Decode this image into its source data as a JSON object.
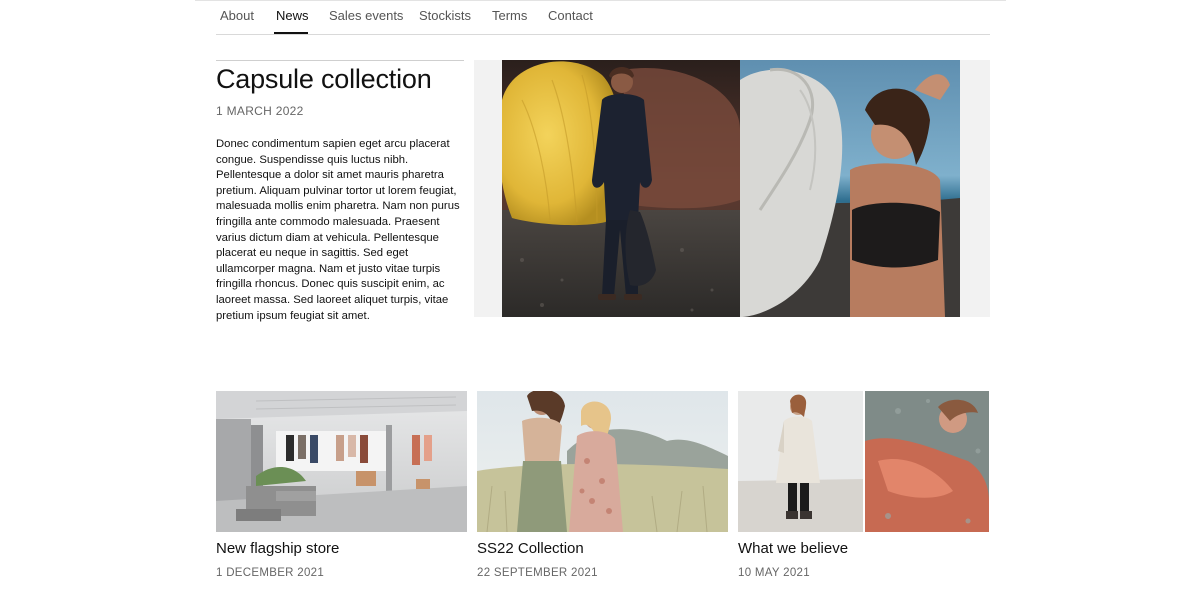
{
  "nav": {
    "items": [
      {
        "label": "About"
      },
      {
        "label": "News",
        "active": true
      },
      {
        "label": "Sales events"
      },
      {
        "label": "Stockists"
      },
      {
        "label": "Terms"
      },
      {
        "label": "Contact"
      }
    ]
  },
  "feature": {
    "title": "Capsule collection",
    "date": "1 MARCH 2022",
    "body": "Donec condimentum sapien eget arcu placerat congue. Suspendisse quis luctus nibh. Pellentesque a dolor sit amet mauris pharetra pretium. Aliquam pulvinar tortor ut lorem feugiat, malesuada mollis enim pharetra. Nam non purus fringilla ante commodo malesuada. Praesent varius dictum diam at vehicula. Pellentesque placerat eu neque in sagittis. Sed eget ullamcorper magna. Nam et justo vitae turpis fringilla rhoncus. Donec quis suscipit enim, ac laoreet massa. Sed laoreet aliquet turpis, vitae pretium ipsum feugiat sit amet."
  },
  "cards": [
    {
      "title": "New flagship store",
      "date": "1 DECEMBER 2021"
    },
    {
      "title": "SS22 Collection",
      "date": "22 SEPTEMBER 2021"
    },
    {
      "title": "What we believe",
      "date": "10 MAY 2021"
    }
  ],
  "colors": {
    "text": "#111111",
    "muted": "#666666",
    "divider": "#d9d9d9",
    "media_bg": "#f2f2f2"
  }
}
